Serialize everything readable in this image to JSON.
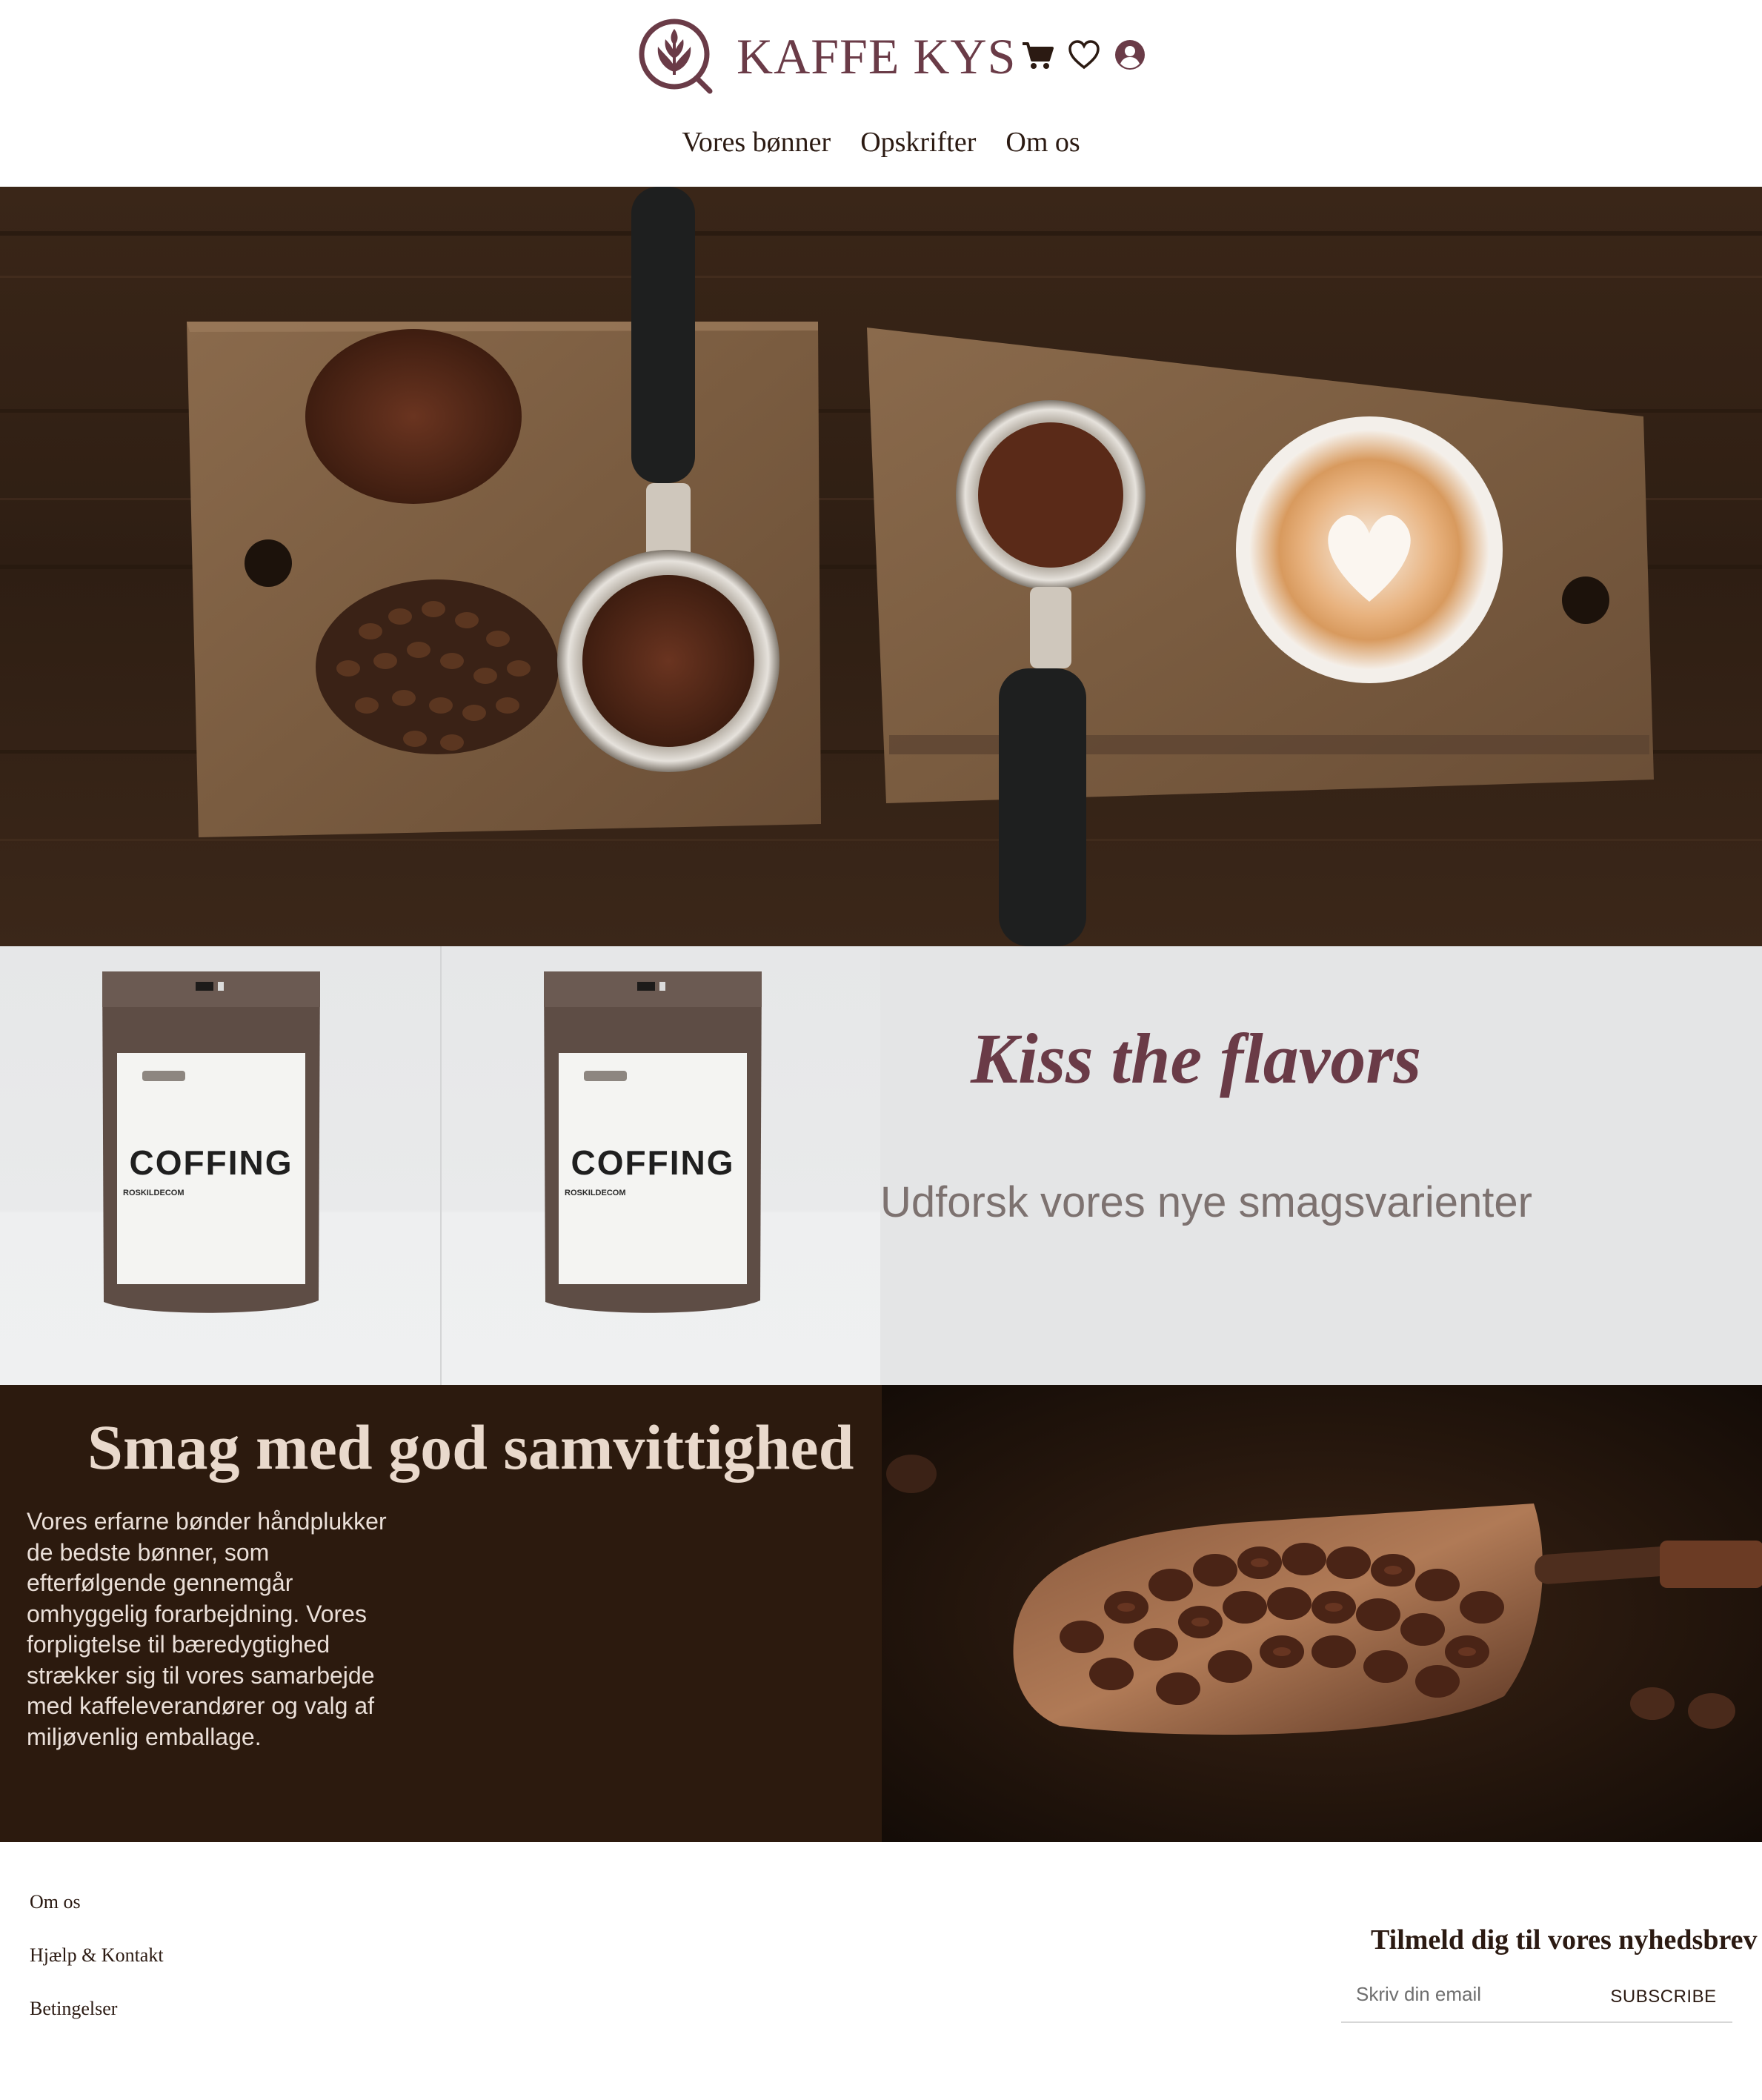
{
  "brand": {
    "name": "KAFFE KYS",
    "color": "#6a3b47"
  },
  "header": {
    "icons": [
      "cart-icon",
      "heart-icon",
      "user-icon"
    ]
  },
  "nav": {
    "items": [
      {
        "label": "Vores bønner"
      },
      {
        "label": "Opskrifter"
      },
      {
        "label": "Om os"
      }
    ]
  },
  "flavors": {
    "title": "Kiss the flavors",
    "subtitle": "Udforsk vores nye smagsvarienter",
    "bag_label": "COFFING",
    "bag_sublabel": "ROSKILDECOM"
  },
  "sustain": {
    "title": "Smag med god samvittighed",
    "text": "Vores erfarne bønder håndplukker de bedste bønner, som efterfølgende gennemgår omhyggelig forarbejdning. Vores forpligtelse til bæredygtighed strækker sig til vores samarbejde med kaffeleverandører og valg af miljøvenlig emballage."
  },
  "footer": {
    "links": [
      {
        "label": "Om os"
      },
      {
        "label": "Hjælp & Kontakt"
      },
      {
        "label": "Betingelser"
      }
    ],
    "newsletter": {
      "title": "Tilmeld dig til vores nyhedsbrev",
      "placeholder": "Skriv din email",
      "button": "SUBSCRIBE"
    }
  },
  "colors": {
    "accent": "#6a3b47",
    "dark_section": "#2c1a0e",
    "light_section": "#e4e5e6"
  }
}
